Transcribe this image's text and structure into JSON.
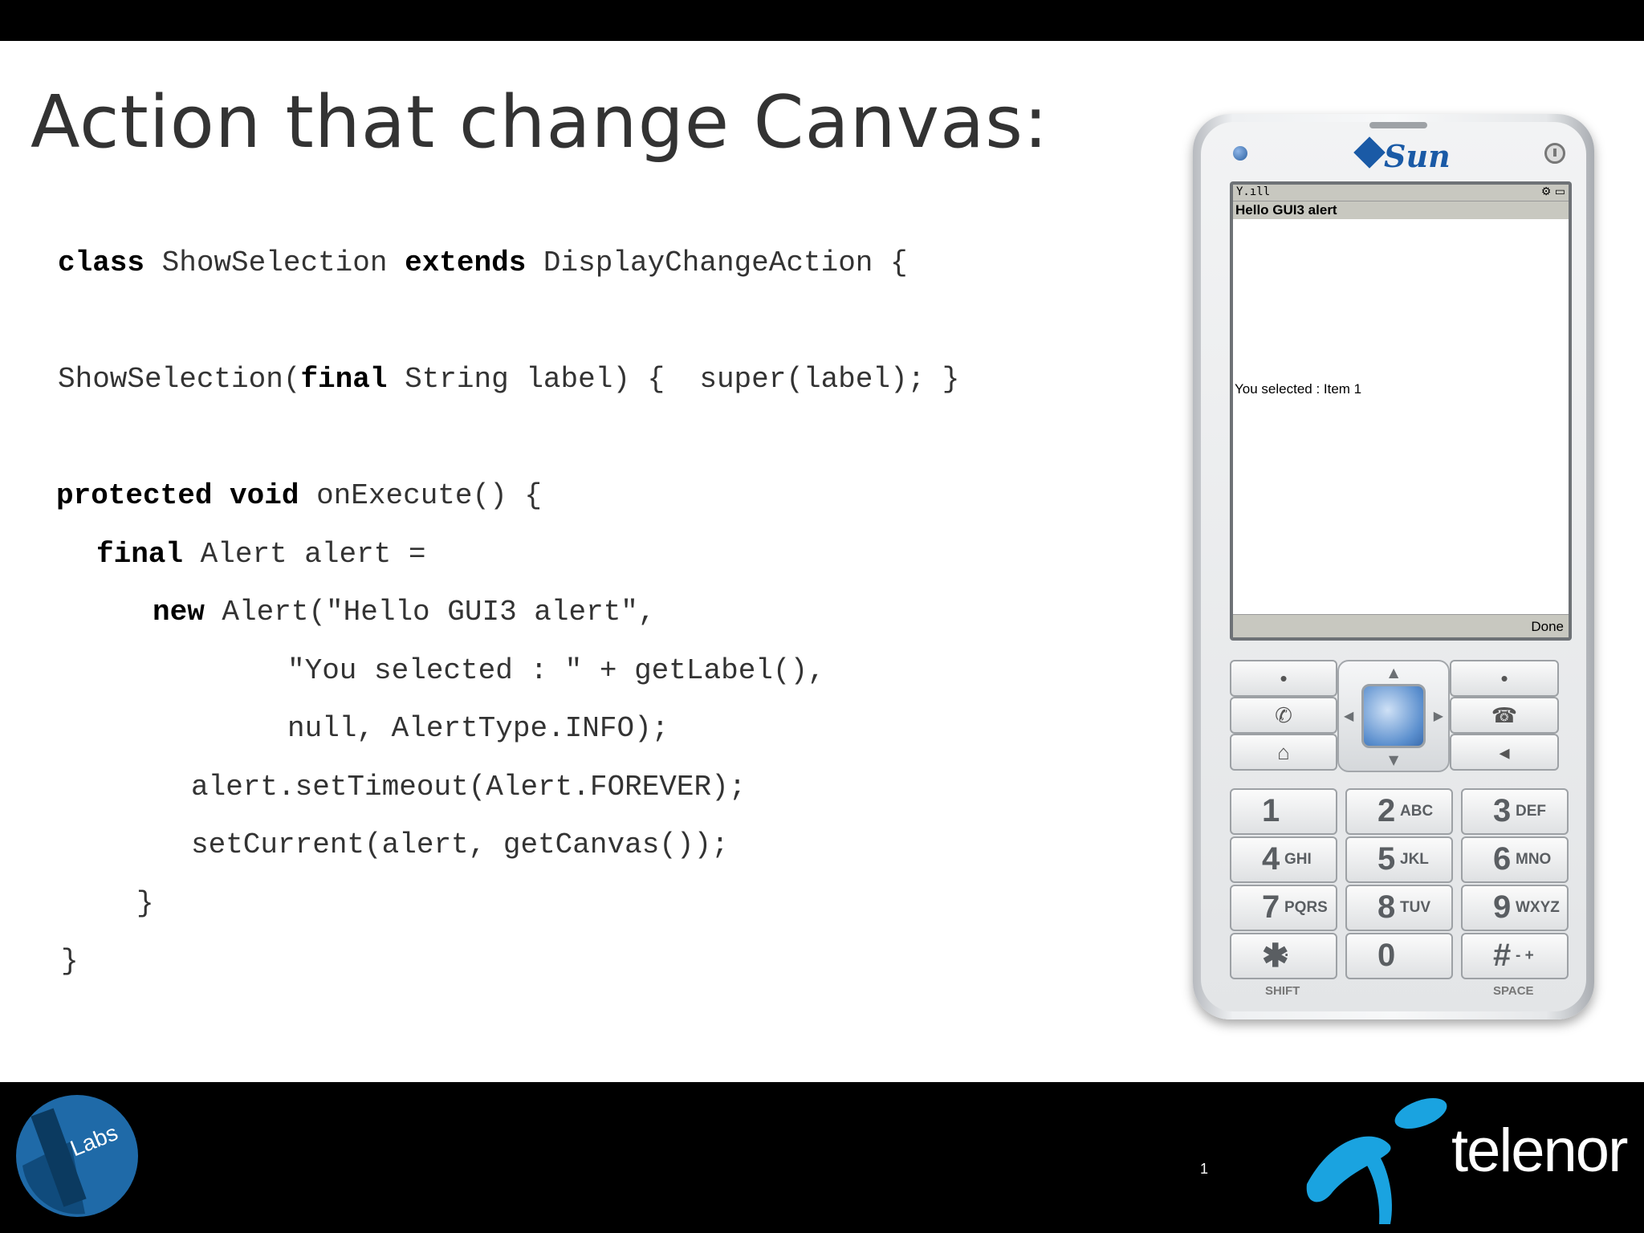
{
  "slide": {
    "title": "Action that change Canvas:",
    "page_number": "1"
  },
  "code": {
    "line1": {
      "kw1": "class",
      "t1": " ShowSelection ",
      "kw2": "extends",
      "t2": " DisplayChangeAction {"
    },
    "line2": {
      "t1": "ShowSelection(",
      "kw1": "final",
      "t2": " String label) {  super(label); }"
    },
    "line3": {
      "kw1": "protected",
      "t1": " ",
      "kw2": "void",
      "t2": " onExecute() {"
    },
    "line4": {
      "kw1": "final",
      "t1": " Alert alert ="
    },
    "line5": {
      "kw1": "new",
      "t1": " Alert(\"Hello GUI3 alert\","
    },
    "line6": "\"You selected : \" + getLabel(),",
    "line7": "null, AlertType.INFO);",
    "line8": "alert.setTimeout(Alert.FOREVER);",
    "line9": "setCurrent(alert, getCanvas());",
    "line10": "}",
    "line11": "}"
  },
  "phone": {
    "brand": "Sun",
    "status_signal": "Y.ıll",
    "status_icons": "⚙ ▭",
    "alert_title": "Hello GUI3 alert",
    "alert_text": "You selected : Item 1",
    "softkey_right": "Done",
    "keys": [
      {
        "big": "1",
        "small": ""
      },
      {
        "big": "2",
        "small": "ABC"
      },
      {
        "big": "3",
        "small": "DEF"
      },
      {
        "big": "4",
        "small": "GHI"
      },
      {
        "big": "5",
        "small": "JKL"
      },
      {
        "big": "6",
        "small": "MNO"
      },
      {
        "big": "7",
        "small": "PQRS"
      },
      {
        "big": "8",
        "small": "TUV"
      },
      {
        "big": "9",
        "small": "WXYZ"
      },
      {
        "big": "✱",
        "small": "·"
      },
      {
        "big": "0",
        "small": ""
      },
      {
        "big": "#",
        "small": "- +"
      }
    ],
    "shift_label": "SHIFT",
    "space_label": "SPACE"
  },
  "footer": {
    "labs_text": "Labs",
    "telenor_text": "telenor"
  },
  "colors": {
    "background": "#ffffff",
    "bars": "#000000",
    "telenor_blue": "#1aa3e0",
    "labs_blue": "#1f6aa8"
  }
}
